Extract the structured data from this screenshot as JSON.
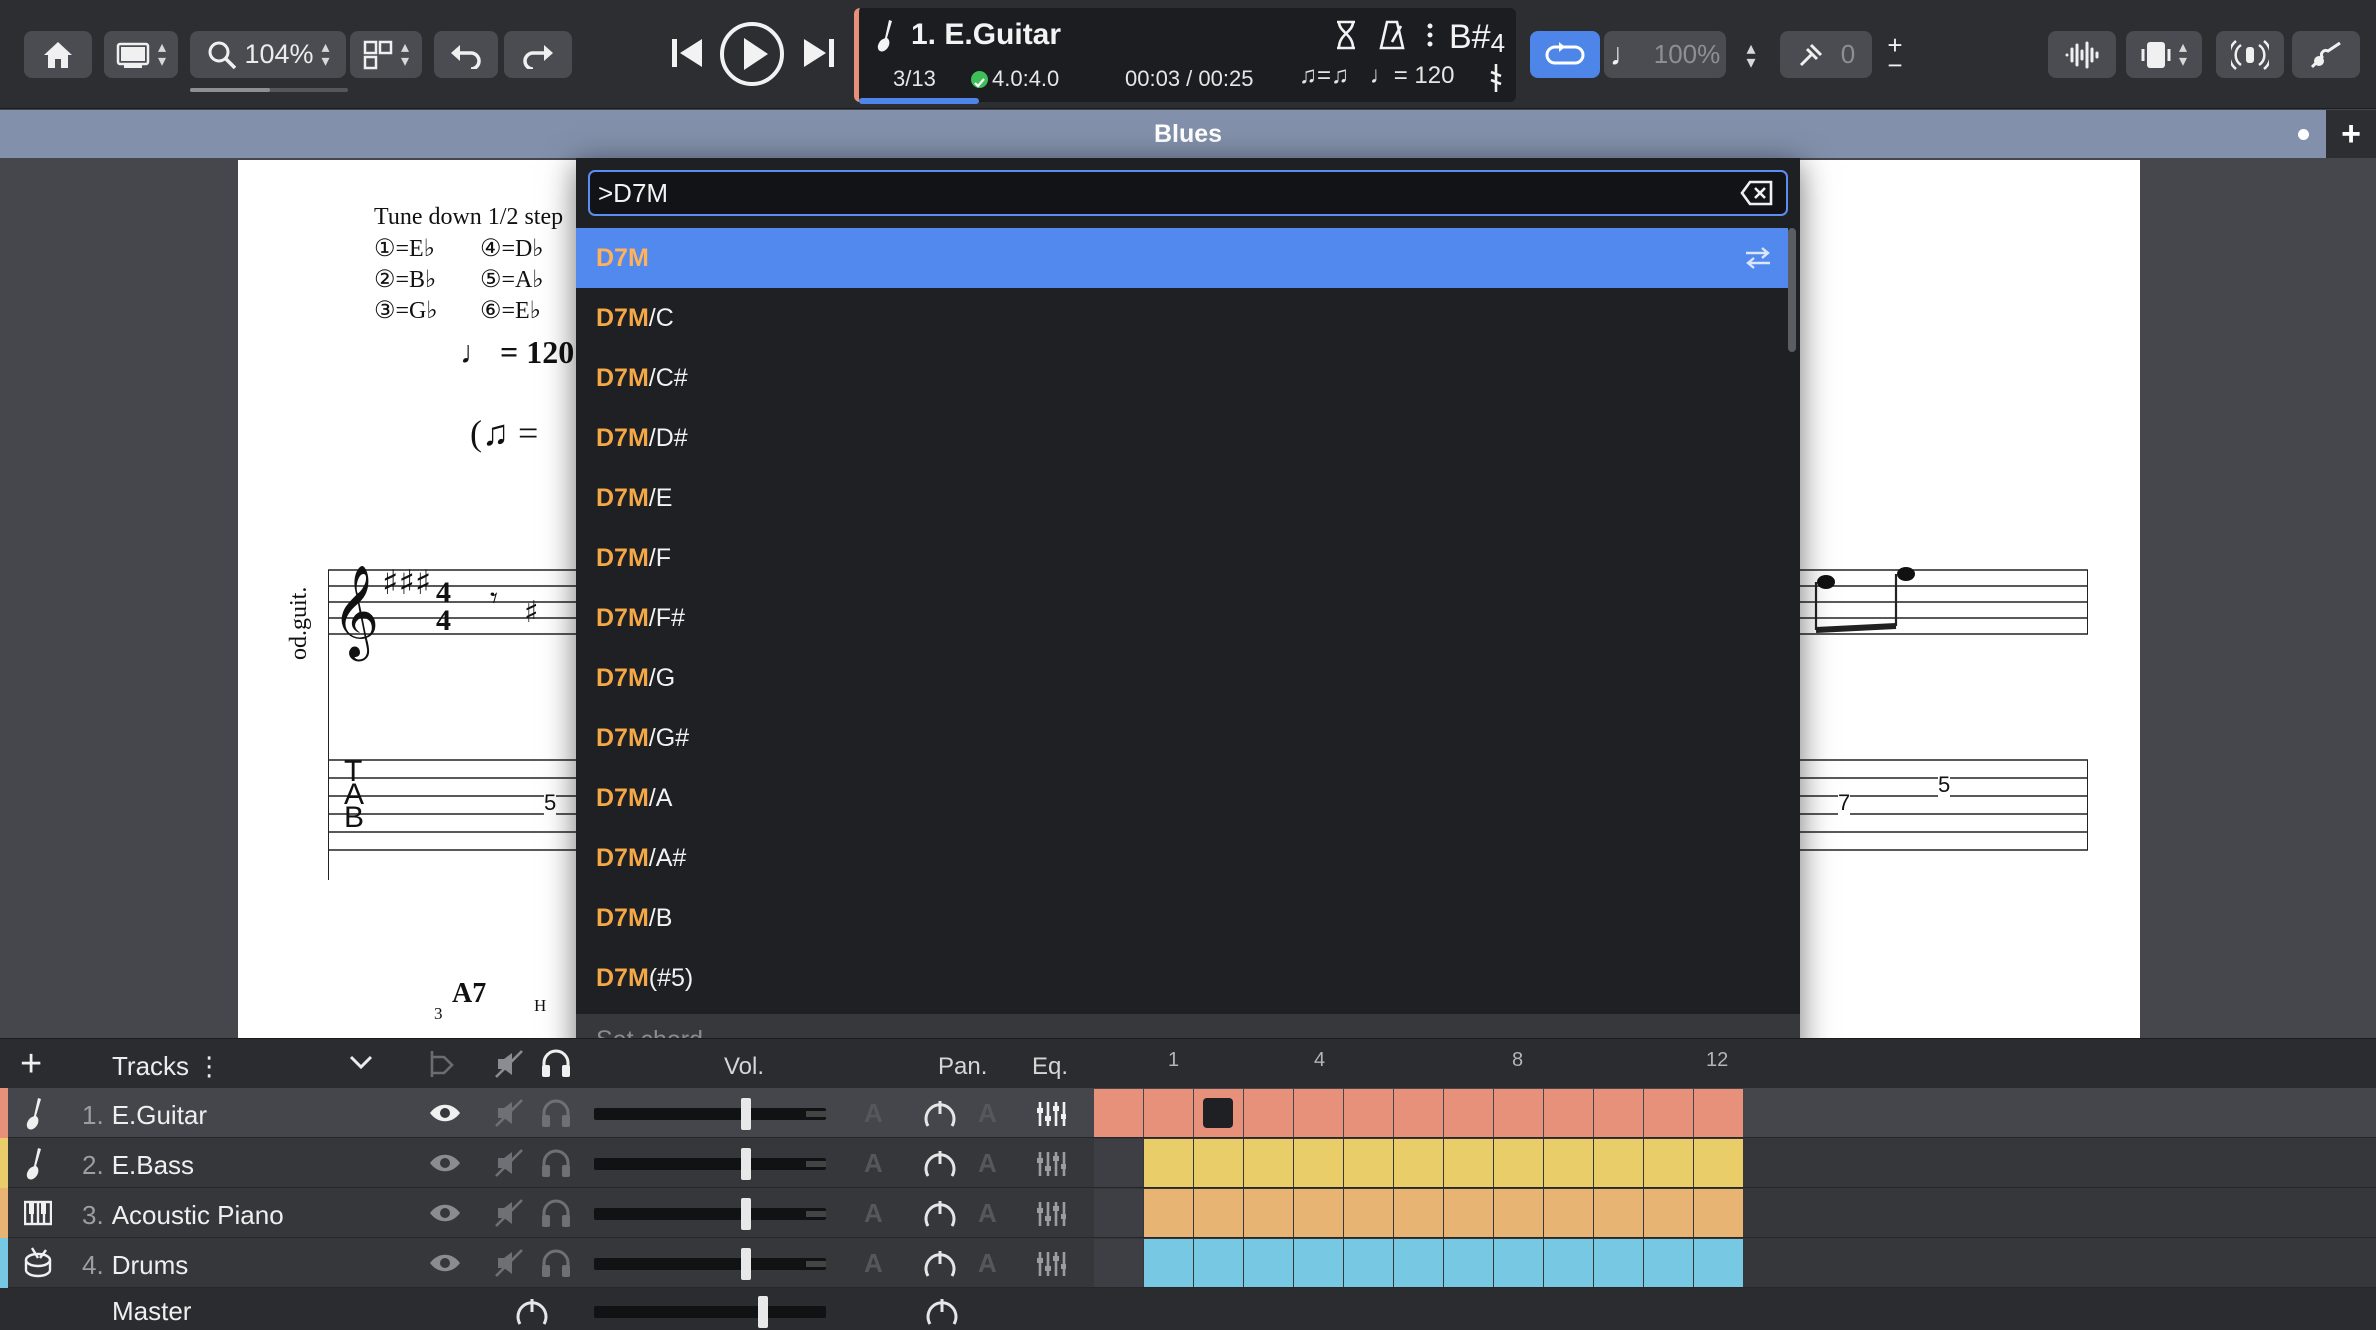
{
  "toolbar": {
    "zoom": "104%",
    "track_title": "1. E.Guitar",
    "bar_position": "3/13",
    "time_signature": "4.0:4.0",
    "time": "00:03 / 00:25",
    "tempo": "= 120",
    "key": "B#",
    "key_octave": "4",
    "playback_speed": "100%",
    "pitch_value": "0"
  },
  "score": {
    "title": "Blues",
    "tuning_header": "Tune down 1/2 step",
    "tuning": [
      "①=E♭",
      "④=D♭",
      "②=B♭",
      "⑤=A♭",
      "③=G♭",
      "⑥=E♭"
    ],
    "tempo_mark": "= 120",
    "triplet_feel": "(",
    "instrument_label": "od.guit.",
    "tab_letters": [
      "T",
      "A",
      "B"
    ],
    "tab_numbers": [
      "5",
      "7",
      "5"
    ],
    "chord_symbol": "A7",
    "hammer": "H",
    "triplet_digit": "3"
  },
  "chord_dropdown": {
    "search_value": ">D7M",
    "items": [
      {
        "root": "D7M",
        "suffix": ""
      },
      {
        "root": "D7M",
        "suffix": "/C"
      },
      {
        "root": "D7M",
        "suffix": "/C#"
      },
      {
        "root": "D7M",
        "suffix": "/D#"
      },
      {
        "root": "D7M",
        "suffix": "/E"
      },
      {
        "root": "D7M",
        "suffix": "/F"
      },
      {
        "root": "D7M",
        "suffix": "/F#"
      },
      {
        "root": "D7M",
        "suffix": "/G"
      },
      {
        "root": "D7M",
        "suffix": "/G#"
      },
      {
        "root": "D7M",
        "suffix": "/A"
      },
      {
        "root": "D7M",
        "suffix": "/A#"
      },
      {
        "root": "D7M",
        "suffix": "/B"
      },
      {
        "root": "D7M",
        "suffix": "(#5)"
      }
    ],
    "footer_placeholder": "Set chord"
  },
  "tracks": {
    "header_label": "Tracks",
    "col_vol": "Vol.",
    "col_pan": "Pan.",
    "col_eq": "Eq.",
    "timeline": [
      "1",
      "4",
      "8",
      "12"
    ],
    "auto_label": "A",
    "list": [
      {
        "num": "1.",
        "name": "E.Guitar",
        "color": "#e8917a",
        "active": true,
        "vol": 0.66
      },
      {
        "num": "2.",
        "name": "E.Bass",
        "color": "#e9cd68",
        "active": false,
        "vol": 0.66
      },
      {
        "num": "3.",
        "name": "Acoustic Piano",
        "color": "#e8b474",
        "active": false,
        "vol": 0.66
      },
      {
        "num": "4.",
        "name": "Drums",
        "color": "#76c8e3",
        "active": false,
        "vol": 0.66
      }
    ],
    "master_label": "Master",
    "master_vol": 0.74
  },
  "colors": {
    "accent": "#5289ef",
    "chord_root": "#f5a846",
    "header_bar": "#8290ab"
  }
}
